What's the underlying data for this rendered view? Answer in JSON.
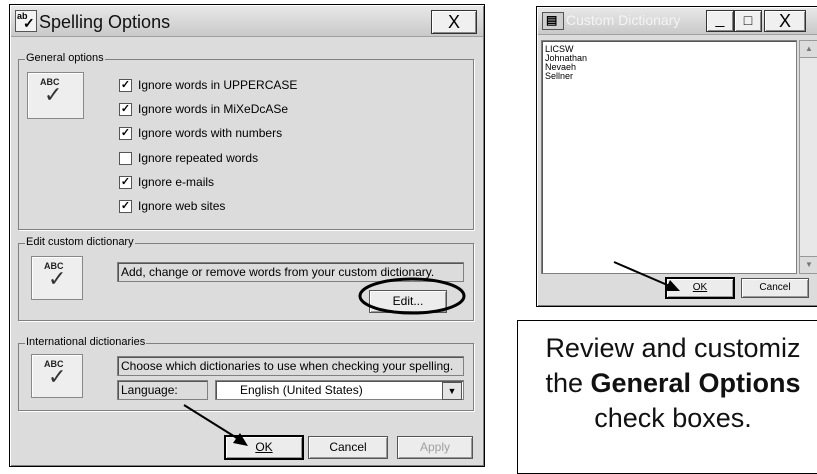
{
  "spelling": {
    "title": "Spelling Options",
    "icon_text": "ab",
    "close": "X",
    "general": {
      "legend": "General options",
      "icon_abc": "ABC",
      "options": [
        {
          "label": "Ignore words in UPPERCASE",
          "checked": true
        },
        {
          "label": "Ignore words in MiXeDcASe",
          "checked": true
        },
        {
          "label": "Ignore words with numbers",
          "checked": true
        },
        {
          "label": "Ignore repeated words",
          "checked": false
        },
        {
          "label": "Ignore e-mails",
          "checked": true
        },
        {
          "label": "Ignore web sites",
          "checked": true
        }
      ]
    },
    "custom": {
      "legend": "Edit custom dictionary",
      "icon_abc": "ABC",
      "description": "Add, change or remove words from your custom dictionary.",
      "edit_label": "Edit..."
    },
    "international": {
      "legend": "International dictionaries",
      "icon_abc": "ABC",
      "description": "Choose which dictionaries to use when checking your spelling.",
      "language_label": "Language:",
      "language_value": "English (United States)"
    },
    "buttons": {
      "ok": "OK",
      "cancel": "Cancel",
      "apply": "Apply"
    }
  },
  "custom_dictionary": {
    "title": "Custom Dictionary",
    "minimize": "_",
    "maximize": "□",
    "close": "X",
    "words": [
      "LICSW",
      "Johnathan",
      "Nevaeh",
      "Sellner"
    ],
    "ok_label": "OK",
    "cancel_label": "Cancel"
  },
  "note": {
    "line1": "Review and customiz",
    "line2_prefix": "the ",
    "line2_bold": "General Options",
    "line3": "check boxes."
  }
}
